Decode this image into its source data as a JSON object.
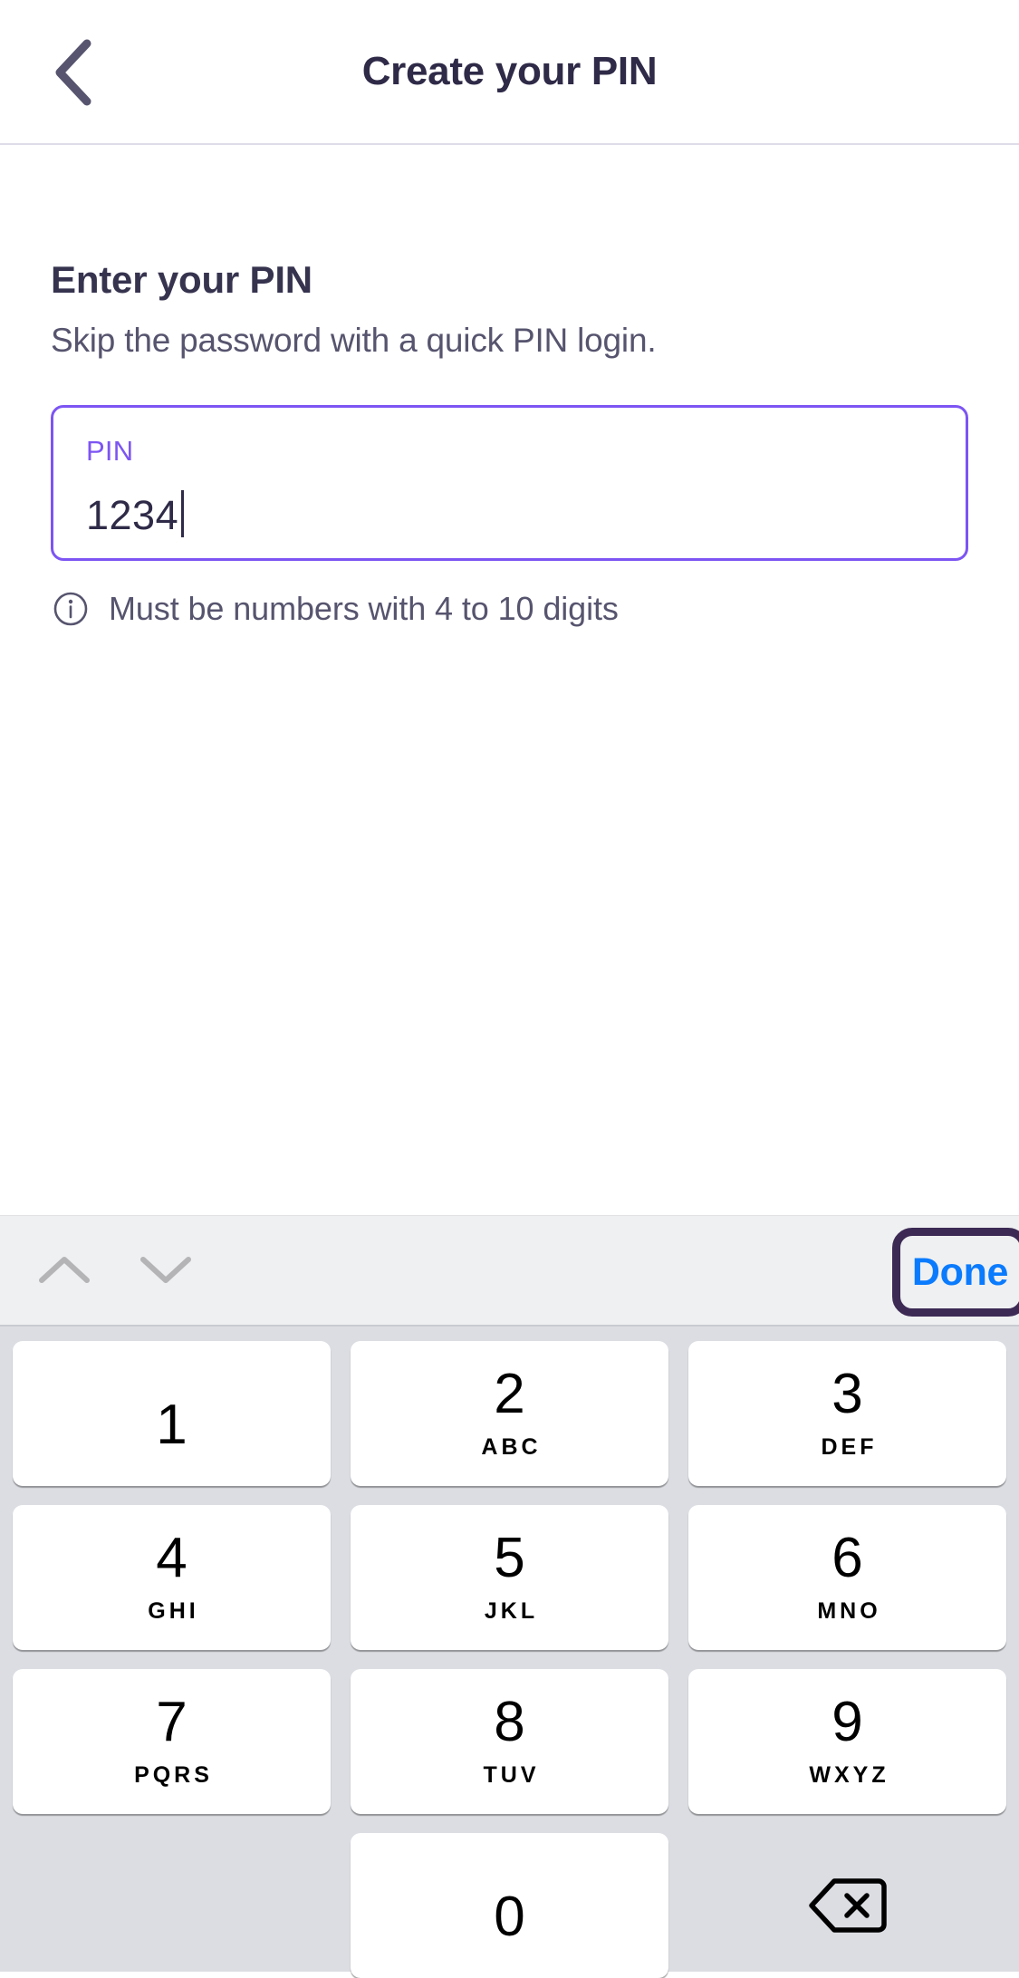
{
  "header": {
    "title": "Create your PIN",
    "back_icon": "chevron-left-icon"
  },
  "main": {
    "section_title": "Enter your PIN",
    "section_subtitle": "Skip the password with a quick PIN login.",
    "pin_field": {
      "label": "PIN",
      "value": "1234",
      "placeholder": "PIN"
    },
    "helper": {
      "icon": "info-circle-icon",
      "text": "Must be numbers with 4 to 10 digits"
    }
  },
  "keyboard": {
    "accessory": {
      "prev_icon": "chevron-up-icon",
      "next_icon": "chevron-down-icon",
      "done_label": "Done"
    },
    "keys": [
      [
        {
          "digit": "1",
          "letters": ""
        },
        {
          "digit": "2",
          "letters": "ABC"
        },
        {
          "digit": "3",
          "letters": "DEF"
        }
      ],
      [
        {
          "digit": "4",
          "letters": "GHI"
        },
        {
          "digit": "5",
          "letters": "JKL"
        },
        {
          "digit": "6",
          "letters": "MNO"
        }
      ],
      [
        {
          "digit": "7",
          "letters": "PQRS"
        },
        {
          "digit": "8",
          "letters": "TUV"
        },
        {
          "digit": "9",
          "letters": "WXYZ"
        }
      ]
    ],
    "zero_key": {
      "digit": "0",
      "letters": ""
    },
    "backspace_icon": "backspace-delete-icon"
  },
  "colors": {
    "accent_purple": "#7d55f3",
    "title_dark": "#2e2a47",
    "body_text": "#56546e",
    "done_blue": "#0b7bfd",
    "focus_ring": "#3c2a55",
    "keypad_bg": "#dbdde2",
    "accessory_bg": "#eff0f1"
  }
}
